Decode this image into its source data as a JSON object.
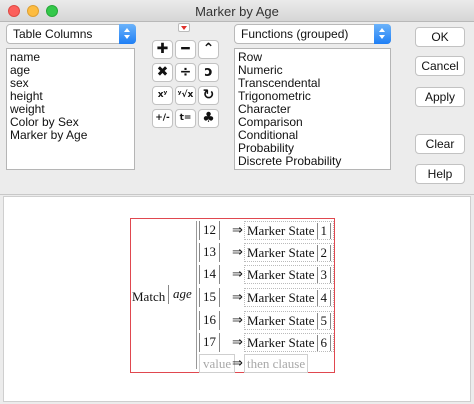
{
  "window": {
    "title": "Marker by Age"
  },
  "columns_select": {
    "value": "Table Columns"
  },
  "columns": [
    "name",
    "age",
    "sex",
    "height",
    "weight",
    "Color by Sex",
    "Marker by Age"
  ],
  "functions_select": {
    "value": "Functions (grouped)"
  },
  "functions": [
    "Row",
    "Numeric",
    "Transcendental",
    "Trigonometric",
    "Character",
    "Comparison",
    "Conditional",
    "Probability",
    "Discrete Probability"
  ],
  "operators": [
    {
      "glyph": "✚",
      "icon": "plus-icon"
    },
    {
      "glyph": "━",
      "icon": "minus-icon"
    },
    {
      "glyph": "⌃",
      "icon": "caret-up-icon"
    },
    {
      "glyph": "✖",
      "icon": "multiply-icon"
    },
    {
      "glyph": "÷",
      "icon": "divide-icon"
    },
    {
      "glyph": "ↄ",
      "icon": "delete-icon"
    },
    {
      "glyph": "xʸ",
      "icon": "power-icon"
    },
    {
      "glyph": "ʸ√x",
      "icon": "root-icon"
    },
    {
      "glyph": "↻",
      "icon": "swap-icon"
    },
    {
      "glyph": "+/-",
      "icon": "plus-minus-icon"
    },
    {
      "glyph": "t=",
      "icon": "assign-icon"
    },
    {
      "glyph": "♣",
      "icon": "peel-icon"
    }
  ],
  "buttons": {
    "ok": "OK",
    "cancel": "Cancel",
    "apply": "Apply",
    "clear": "Clear",
    "help": "Help"
  },
  "formula": {
    "function_name": "Match",
    "argument": "age",
    "cases": [
      {
        "condition": "12",
        "arrow": "⇒",
        "then": "Marker State",
        "then_arg": "1"
      },
      {
        "condition": "13",
        "arrow": "⇒",
        "then": "Marker State",
        "then_arg": "2"
      },
      {
        "condition": "14",
        "arrow": "⇒",
        "then": "Marker State",
        "then_arg": "3"
      },
      {
        "condition": "15",
        "arrow": "⇒",
        "then": "Marker State",
        "then_arg": "4"
      },
      {
        "condition": "16",
        "arrow": "⇒",
        "then": "Marker State",
        "then_arg": "5"
      },
      {
        "condition": "17",
        "arrow": "⇒",
        "then": "Marker State",
        "then_arg": "6"
      }
    ],
    "placeholder": {
      "condition": "value",
      "arrow": "⇒",
      "then": "then clause"
    }
  },
  "colors": {
    "accent": "#1f7ff5",
    "formula_border": "#e0484f"
  }
}
